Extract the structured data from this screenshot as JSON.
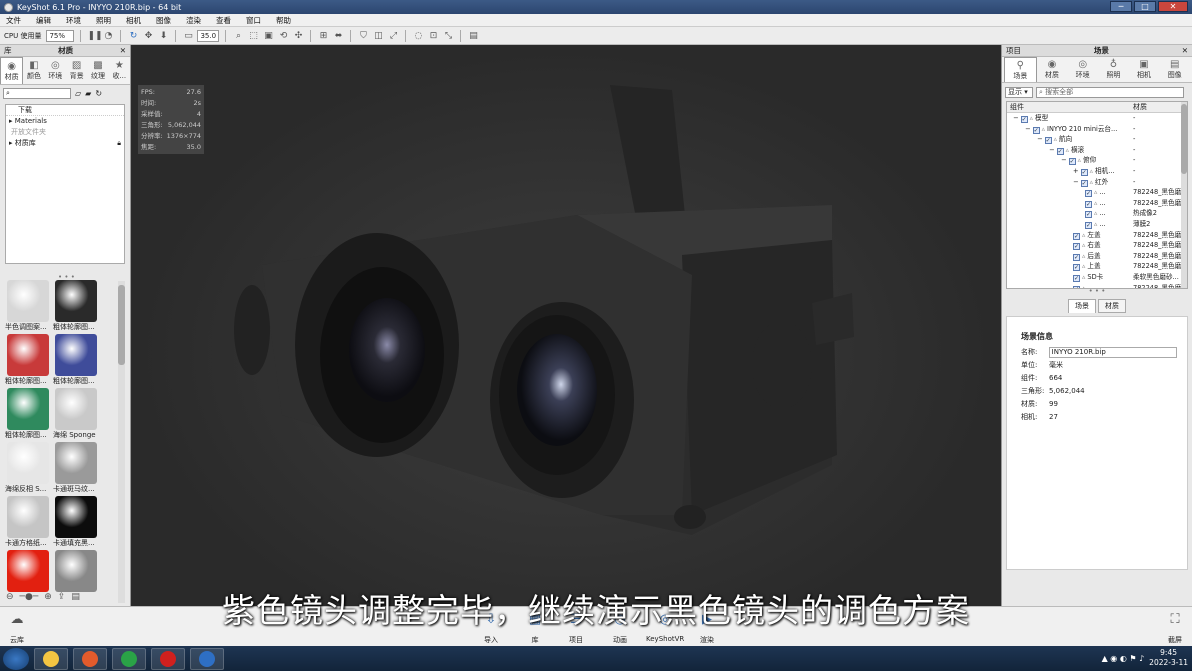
{
  "window": {
    "title": "KeyShot 6.1 Pro  - INYYO 210R.bip  - 64 bit",
    "minimize": "─",
    "maximize": "□",
    "close": "✕"
  },
  "menu": [
    "文件",
    "编辑",
    "环境",
    "照明",
    "相机",
    "图像",
    "渲染",
    "查看",
    "窗口",
    "帮助"
  ],
  "toolbar": {
    "cpu_label": "CPU 使用量",
    "cpu_value": "75%",
    "focal_value": "35.0"
  },
  "left_panel": {
    "header_left": "库",
    "header_right": "材质",
    "tabs": [
      {
        "label": "材质",
        "icon": "material-icon"
      },
      {
        "label": "颜色",
        "icon": "color-icon"
      },
      {
        "label": "环境",
        "icon": "environment-icon"
      },
      {
        "label": "背景",
        "icon": "background-icon"
      },
      {
        "label": "纹理",
        "icon": "texture-icon"
      },
      {
        "label": "收...",
        "icon": "favorite-icon"
      }
    ],
    "tree": [
      "下载",
      "Materials",
      "开放文件夹",
      "材质库"
    ],
    "materials": [
      {
        "label": "半色调图案...",
        "color": "#d7d7d7"
      },
      {
        "label": "粗体轮廓图...",
        "color": "#2a2a2a"
      },
      {
        "label": "粗体轮廓图...",
        "color": "#c83a3a"
      },
      {
        "label": "粗体轮廓图...",
        "color": "#3f4c9a"
      },
      {
        "label": "粗体轮廓图...",
        "color": "#2f8a5e"
      },
      {
        "label": "海绵 Sponge",
        "color": "#c9c9c9"
      },
      {
        "label": "海绵反相 S...",
        "color": "#e6e6e6"
      },
      {
        "label": "卡通斑马纹...",
        "color": "#9a9a9a"
      },
      {
        "label": "卡通方格纸...",
        "color": "#c5c5c5"
      },
      {
        "label": "卡通填充黑...",
        "color": "#0c0c0c"
      },
      {
        "label": "",
        "color": "#e22010"
      },
      {
        "label": "",
        "color": "#888888"
      }
    ]
  },
  "stats": [
    {
      "k": "FPS:",
      "v": "27.6"
    },
    {
      "k": "时间:",
      "v": "2s"
    },
    {
      "k": "采样值:",
      "v": "4"
    },
    {
      "k": "三角形:",
      "v": "5,062,044"
    },
    {
      "k": "分辨率:",
      "v": "1376×774"
    },
    {
      "k": "焦距:",
      "v": "35.0"
    }
  ],
  "right_panel": {
    "header_left": "项目",
    "header_right": "场景",
    "tabs": [
      {
        "label": "场景",
        "icon": "scene-icon"
      },
      {
        "label": "材质",
        "icon": "material-icon"
      },
      {
        "label": "环境",
        "icon": "environment-icon"
      },
      {
        "label": "照明",
        "icon": "lighting-icon"
      },
      {
        "label": "相机",
        "icon": "camera-icon"
      },
      {
        "label": "图像",
        "icon": "image-icon"
      }
    ],
    "display": "显示 ▾",
    "search_placeholder": "搜索全部",
    "col_component": "组件",
    "col_material": "材质",
    "rows": [
      {
        "name": "模型",
        "mat": "-",
        "indent": 2,
        "exp": "−"
      },
      {
        "name": "INYYO 210 mini云台...",
        "mat": "-",
        "indent": 3,
        "exp": "−"
      },
      {
        "name": "航向",
        "mat": "-",
        "indent": 4,
        "exp": "−"
      },
      {
        "name": "横滚",
        "mat": "-",
        "indent": 5,
        "exp": "−"
      },
      {
        "name": "俯仰",
        "mat": "-",
        "indent": 6,
        "exp": "−"
      },
      {
        "name": "相机...",
        "mat": "-",
        "indent": 7,
        "exp": "+"
      },
      {
        "name": "红外",
        "mat": "-",
        "indent": 7,
        "exp": "−"
      },
      {
        "name": "...",
        "mat": "782248_黑色磨",
        "indent": 8,
        "exp": ""
      },
      {
        "name": "...",
        "mat": "782248_黑色磨",
        "indent": 8,
        "exp": ""
      },
      {
        "name": "...",
        "mat": "热成像2",
        "indent": 8,
        "exp": ""
      },
      {
        "name": "...",
        "mat": "薄膜2",
        "indent": 8,
        "exp": ""
      },
      {
        "name": "左盖",
        "mat": "782248_黑色磨",
        "indent": 7,
        "exp": ""
      },
      {
        "name": "右盖",
        "mat": "782248_黑色磨",
        "indent": 7,
        "exp": ""
      },
      {
        "name": "后盖",
        "mat": "782248_黑色磨",
        "indent": 7,
        "exp": ""
      },
      {
        "name": "上盖",
        "mat": "782248_黑色磨",
        "indent": 7,
        "exp": ""
      },
      {
        "name": "SD卡",
        "mat": "柔软黑色磨砂...",
        "indent": 7,
        "exp": ""
      },
      {
        "name": "...",
        "mat": "782248_黑色磨",
        "indent": 7,
        "exp": ""
      }
    ],
    "subtab_scene": "场景",
    "subtab_material": "材质",
    "info_title": "场景信息",
    "info": {
      "name_label": "名称:",
      "name": "INYYO 210R.bip",
      "unit_label": "单位:",
      "unit": "毫米",
      "parts_label": "组件:",
      "parts": "664",
      "tri_label": "三角形:",
      "tri": "5,062,044",
      "mat_label": "材质:",
      "mat": "99",
      "cam_label": "相机:",
      "cam": "27"
    }
  },
  "bottom": {
    "cloud": "云库",
    "buttons": [
      {
        "label": "导入",
        "icon": "import-icon",
        "glyph": "⇩"
      },
      {
        "label": "库",
        "icon": "library-icon",
        "glyph": "▦"
      },
      {
        "label": "项目",
        "icon": "project-icon",
        "glyph": "☰"
      },
      {
        "label": "动画",
        "icon": "animation-icon",
        "glyph": "◷"
      },
      {
        "label": "KeyShotVR",
        "icon": "vr-icon",
        "glyph": "◎"
      },
      {
        "label": "渲染",
        "icon": "render-icon",
        "glyph": "▶"
      }
    ],
    "screenshot": "截屏"
  },
  "subtitle": "紫色镜头调整完毕，继续演示黑色镜头的调色方案",
  "taskbar": {
    "time": "9:45",
    "date": "2022-3-11",
    "apps": [
      "#f4c542",
      "#e25b2c",
      "#2aa347",
      "#d0201e",
      "#2e6fc4"
    ]
  }
}
